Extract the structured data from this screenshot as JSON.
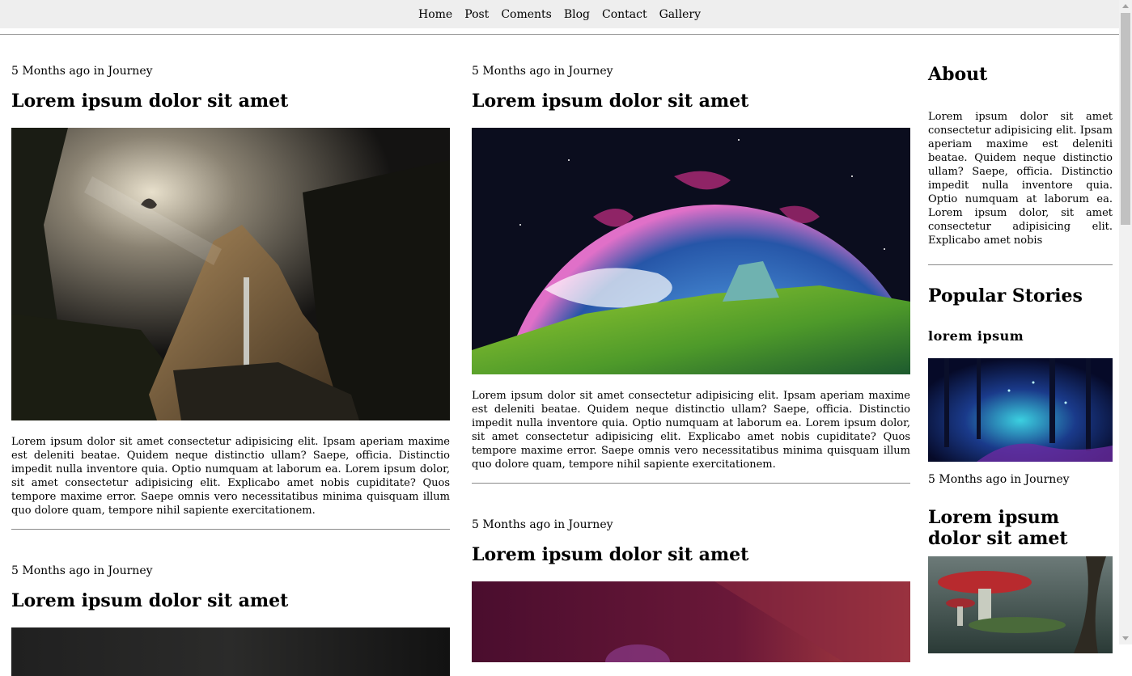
{
  "nav": {
    "items": [
      "Home",
      "Post",
      "Coments",
      "Blog",
      "Contact",
      "Gallery"
    ]
  },
  "posts_left": [
    {
      "meta": "5 Months ago in Journey",
      "title": "Lorem ipsum dolor sit amet",
      "image": "fantasy-waterfall-dragon-landscape",
      "body": "Lorem ipsum dolor sit amet consectetur adipisicing elit. Ipsam aperiam maxime est deleniti beatae. Quidem neque distinctio ullam? Saepe, officia. Distinctio impedit nulla inventore quia. Optio numquam at laborum ea. Lorem ipsum dolor, sit amet consectetur adipisicing elit. Explicabo amet nobis cupiditate? Quos tempore maxime error. Saepe omnis vero necessitatibus minima quisquam illum quo dolore quam, tempore nihil sapiente exercitationem."
    },
    {
      "meta": "5 Months ago in Journey",
      "title": "Lorem ipsum dolor sit amet",
      "image": "dark-forest-image"
    }
  ],
  "posts_mid": [
    {
      "meta": "5 Months ago in Journey",
      "title": "Lorem ipsum dolor sit amet",
      "image": "planet-over-green-hill",
      "body": "Lorem ipsum dolor sit amet consectetur adipisicing elit. Ipsam aperiam maxime est deleniti beatae. Quidem neque distinctio ullam? Saepe, officia. Distinctio impedit nulla inventore quia. Optio numquam at laborum ea. Lorem ipsum dolor, sit amet consectetur adipisicing elit. Explicabo amet nobis cupiditate? Quos tempore maxime error. Saepe omnis vero necessitatibus minima quisquam illum quo dolore quam, tempore nihil sapiente exercitationem."
    },
    {
      "meta": "5 Months ago in Journey",
      "title": "Lorem ipsum dolor sit amet",
      "image": "purple-abstract-image"
    }
  ],
  "sidebar": {
    "about_heading": "About",
    "about_text": "Lorem ipsum dolor sit amet consectetur adipisicing elit. Ipsam aperiam maxime est deleniti beatae. Quidem neque distinctio ullam? Saepe, officia. Distinctio impedit nulla inventore quia. Optio numquam at laborum ea. Lorem ipsum dolor, sit amet consectetur adipisicing elit. Explicabo amet nobis",
    "popular_heading": "Popular Stories",
    "story_title": "lorem ipsum",
    "story_image": "glowing-blue-forest",
    "story_meta": "5 Months ago in Journey",
    "story2_heading": "Lorem ipsum dolor sit amet",
    "story2_image": "giant-red-mushrooms"
  }
}
